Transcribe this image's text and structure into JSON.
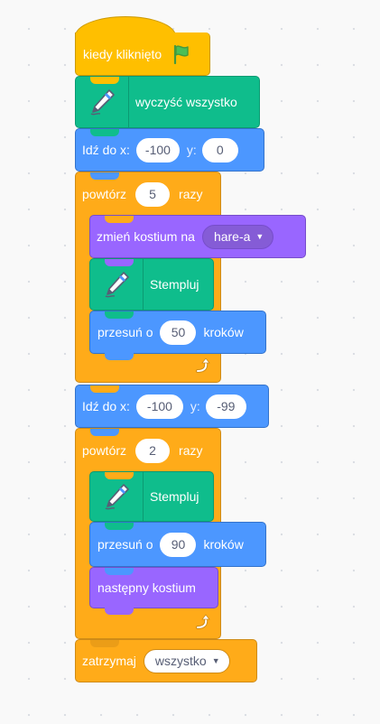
{
  "palette": {
    "events": "#ffbf00",
    "control": "#ffab19",
    "motion": "#4c97ff",
    "looks": "#9966ff",
    "pen": "#0fbd8c"
  },
  "script": {
    "hat": {
      "text": "kiedy kliknięto",
      "icon": "green-flag-icon"
    },
    "clear": {
      "text": "wyczyść wszystko",
      "icon": "pen-icon"
    },
    "goto1": {
      "prefix": "Idź do x:",
      "x": "-100",
      "ylabel": "y:",
      "y": "0"
    },
    "repeat1": {
      "prefix": "powtórz",
      "times": "5",
      "suffix": "razy",
      "switch_costume": {
        "text": "zmień kostium na",
        "costume": "hare-a"
      },
      "stamp": {
        "text": "Stempluj",
        "icon": "pen-icon"
      },
      "move": {
        "prefix": "przesuń o",
        "steps": "50",
        "suffix": "kroków"
      },
      "loop_icon": "loop-arrow-icon"
    },
    "goto2": {
      "prefix": "Idź do x:",
      "x": "-100",
      "ylabel": "y:",
      "y": "-99"
    },
    "repeat2": {
      "prefix": "powtórz",
      "times": "2",
      "suffix": "razy",
      "stamp": {
        "text": "Stempluj",
        "icon": "pen-icon"
      },
      "move": {
        "prefix": "przesuń o",
        "steps": "90",
        "suffix": "kroków"
      },
      "next_costume": {
        "text": "następny kostium"
      },
      "loop_icon": "loop-arrow-icon"
    },
    "stop": {
      "prefix": "zatrzymaj",
      "option": "wszystko"
    }
  }
}
